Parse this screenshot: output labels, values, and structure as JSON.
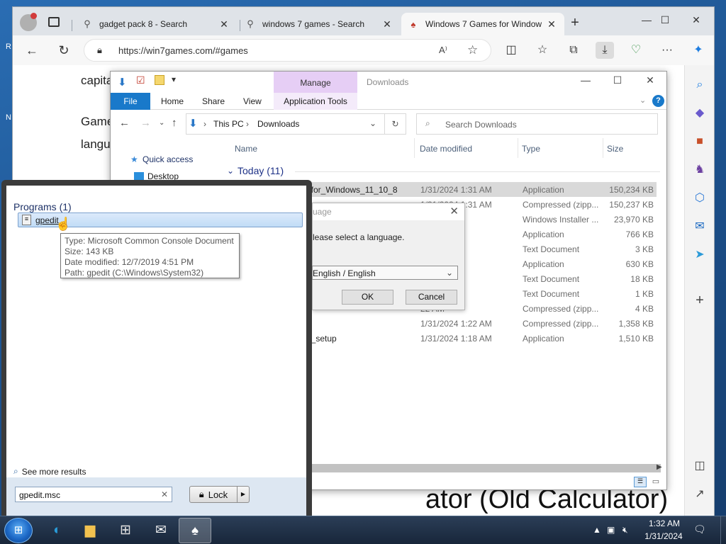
{
  "browser": {
    "tabs": [
      {
        "title": "gadget pack 8 - Search",
        "icon": "search-icon"
      },
      {
        "title": "windows 7 games - Search",
        "icon": "search-icon"
      },
      {
        "title": "Windows 7 Games for Window",
        "icon": "site-favicon"
      }
    ],
    "new_tab": "+",
    "url": "https://win7games.com/#games",
    "page": {
      "line1": "capitalized",
      "line2": "Game",
      "line3": "langu",
      "heading": "ator (Old Calculator)"
    }
  },
  "explorer": {
    "manage_label": "Manage",
    "title": "Downloads",
    "ribbon": {
      "file": "File",
      "home": "Home",
      "share": "Share",
      "view": "View",
      "app_tools": "Application Tools"
    },
    "breadcrumb": [
      "This PC",
      "Downloads"
    ],
    "search_placeholder": "Search Downloads",
    "columns": {
      "name": "Name",
      "date": "Date modified",
      "type": "Type",
      "size": "Size"
    },
    "group": "Today (11)",
    "nav": {
      "quick_access": "Quick access",
      "desktop": "Desktop"
    },
    "rows": [
      {
        "name": "s_for_Windows_11_10_8",
        "date": "1/31/2024 1:31 AM",
        "type": "Application",
        "size": "150,234 KB",
        "selected": true
      },
      {
        "name": "",
        "date": "1/31/2024 1:31 AM",
        "type": "Compressed (zipp...",
        "size": "150,237 KB"
      },
      {
        "name": "",
        "date": "29 AM",
        "type": "Windows Installer ...",
        "size": "23,970 KB"
      },
      {
        "name": "",
        "date": "23 AM",
        "type": "Application",
        "size": "766 KB"
      },
      {
        "name": "",
        "date": "23 AM",
        "type": "Text Document",
        "size": "3 KB"
      },
      {
        "name": "",
        "date": "23 AM",
        "type": "Application",
        "size": "630 KB"
      },
      {
        "name": "",
        "date": "22 AM",
        "type": "Text Document",
        "size": "18 KB"
      },
      {
        "name": "",
        "date": "23 AM",
        "type": "Text Document",
        "size": "1 KB"
      },
      {
        "name": "",
        "date": "22 AM",
        "type": "Compressed (zipp...",
        "size": "4 KB"
      },
      {
        "name": "",
        "date": "1/31/2024 1:22 AM",
        "type": "Compressed (zipp...",
        "size": "1,358 KB"
      },
      {
        "name": "us_setup",
        "date": "1/31/2024 1:18 AM",
        "type": "Application",
        "size": "1,510 KB"
      }
    ]
  },
  "language_dialog": {
    "title": "uage",
    "prompt": "lease select a language.",
    "selected": "English / English",
    "ok": "OK",
    "cancel": "Cancel"
  },
  "start_menu": {
    "programs_header": "Programs (1)",
    "result": "gpedit",
    "tooltip": {
      "type": "Type: Microsoft Common Console Document",
      "size": "Size: 143 KB",
      "date": "Date modified: 12/7/2019 4:51 PM",
      "path": "Path: gpedit (C:\\Windows\\System32)"
    },
    "see_more": "See more results",
    "search_value": "gpedit.msc",
    "lock": "Lock"
  },
  "taskbar": {
    "time": "1:32 AM",
    "date": "1/31/2024"
  },
  "desktop": {
    "letters": [
      "R",
      "N"
    ]
  },
  "colors": {
    "accent": "#1979ca",
    "taskbar": "#18263a",
    "manage_tab": "#e6cef5"
  }
}
